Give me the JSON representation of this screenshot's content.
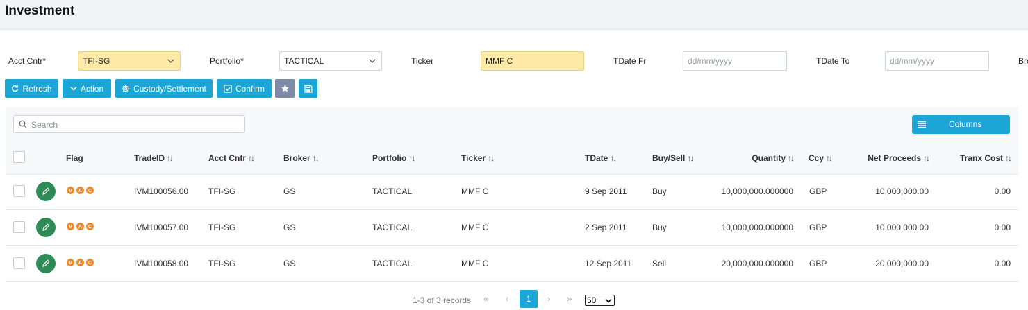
{
  "page": {
    "title": "Investment"
  },
  "filters": {
    "acct_cntr": {
      "label": "Acct Cntr*",
      "value": "TFI-SG"
    },
    "portfolio": {
      "label": "Portfolio*",
      "value": "TACTICAL"
    },
    "ticker": {
      "label": "Ticker",
      "value": "MMF C"
    },
    "tdate_fr": {
      "label": "TDate Fr",
      "placeholder": "dd/mm/yyyy"
    },
    "tdate_to": {
      "label": "TDate To",
      "placeholder": "dd/mm/yyyy"
    },
    "broker_truncated": {
      "label": "Bro"
    }
  },
  "toolbar": {
    "refresh": "Refresh",
    "action": "Action",
    "custody": "Custody/Settlement",
    "confirm": "Confirm",
    "favorite_icon": "star-icon",
    "save_icon": "save-icon"
  },
  "grid": {
    "search_placeholder": "Search",
    "columns_button": "Columns",
    "headers": {
      "flag": "Flag",
      "trade_id": "TradeID",
      "acct_cntr": "Acct Cntr",
      "broker": "Broker",
      "portfolio": "Portfolio",
      "ticker": "Ticker",
      "tdate": "TDate",
      "buy_sell": "Buy/Sell",
      "quantity": "Quantity",
      "ccy": "Ccy",
      "net_proceeds": "Net Proceeds",
      "tranx_cost": "Tranx Cost"
    },
    "sort_glyph": "↑↓",
    "flag_letters": [
      "V",
      "A",
      "C"
    ],
    "rows": [
      {
        "trade_id": "IVM100056.00",
        "acct_cntr": "TFI-SG",
        "broker": "GS",
        "portfolio": "TACTICAL",
        "ticker": "MMF C",
        "tdate": "9 Sep 2011",
        "buy_sell": "Buy",
        "quantity": "10,000,000.000000",
        "ccy": "GBP",
        "net_proceeds": "10,000,000.00",
        "tranx_cost": "0.00"
      },
      {
        "trade_id": "IVM100057.00",
        "acct_cntr": "TFI-SG",
        "broker": "GS",
        "portfolio": "TACTICAL",
        "ticker": "MMF C",
        "tdate": "2 Sep 2011",
        "buy_sell": "Buy",
        "quantity": "10,000,000.000000",
        "ccy": "GBP",
        "net_proceeds": "10,000,000.00",
        "tranx_cost": "0.00"
      },
      {
        "trade_id": "IVM100058.00",
        "acct_cntr": "TFI-SG",
        "broker": "GS",
        "portfolio": "TACTICAL",
        "ticker": "MMF C",
        "tdate": "12 Sep 2011",
        "buy_sell": "Sell",
        "quantity": "20,000,000.000000",
        "ccy": "GBP",
        "net_proceeds": "20,000,000.00",
        "tranx_cost": "0.00"
      }
    ]
  },
  "pagination": {
    "summary": "1-3 of 3 records",
    "current_page": "1",
    "page_size": "50",
    "first": "«",
    "prev": "‹",
    "next": "›",
    "last": "»"
  },
  "colors": {
    "accent": "#1ba6d6",
    "required_field_bg": "#fdeaa7",
    "edit_button": "#2e8b57",
    "flag_badge": "#f0892b"
  }
}
